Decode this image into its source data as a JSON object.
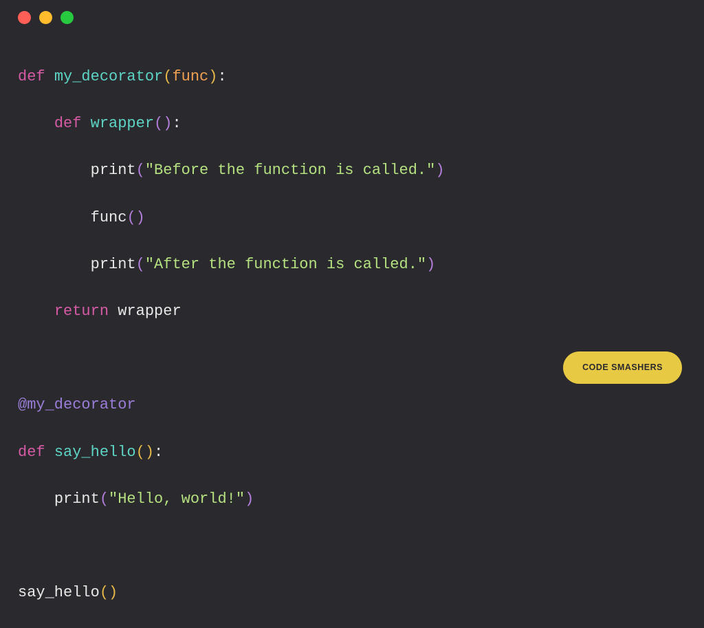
{
  "window": {
    "controls": [
      "close",
      "minimize",
      "maximize"
    ]
  },
  "code": {
    "line1": {
      "def": "def",
      "sp1": " ",
      "fname": "my_decorator",
      "lp": "(",
      "param": "func",
      "rp": ")",
      "colon": ":"
    },
    "line2": {
      "indent": "    ",
      "def": "def",
      "sp1": " ",
      "fname": "wrapper",
      "lp": "(",
      "rp": ")",
      "colon": ":"
    },
    "line3": {
      "indent": "        ",
      "fn": "print",
      "lp": "(",
      "str": "\"Before the function is called.\"",
      "rp": ")"
    },
    "line4": {
      "indent": "        ",
      "fn": "func",
      "lp": "(",
      "rp": ")"
    },
    "line5": {
      "indent": "        ",
      "fn": "print",
      "lp": "(",
      "str": "\"After the function is called.\"",
      "rp": ")"
    },
    "line6": {
      "indent": "    ",
      "ret": "return",
      "sp1": " ",
      "name": "wrapper"
    },
    "line7": {
      "blank": ""
    },
    "line8": {
      "dec": "@my_decorator"
    },
    "line9": {
      "def": "def",
      "sp1": " ",
      "fname": "say_hello",
      "lp": "(",
      "rp": ")",
      "colon": ":"
    },
    "line10": {
      "indent": "    ",
      "fn": "print",
      "lp": "(",
      "str": "\"Hello, world!\"",
      "rp": ")"
    },
    "line11": {
      "blank": ""
    },
    "line12": {
      "fn": "say_hello",
      "lp": "(",
      "rp": ")"
    }
  },
  "badge": {
    "label": "CODE SMASHERS"
  }
}
